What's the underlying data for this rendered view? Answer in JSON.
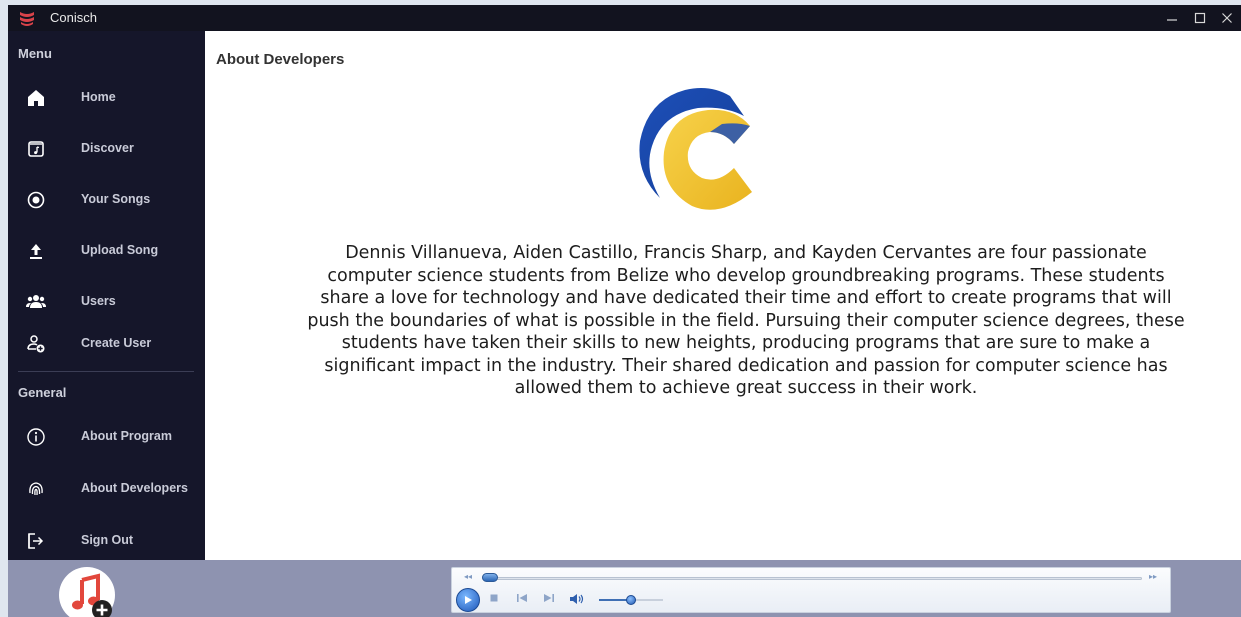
{
  "window": {
    "title": "Conisch",
    "controls": [
      "minimize-icon",
      "maximize-icon",
      "close-icon"
    ]
  },
  "sidebar": {
    "menu_title": "Menu",
    "menu_items": [
      {
        "label": "Home",
        "icon": "home-icon"
      },
      {
        "label": "Discover",
        "icon": "music-note-icon"
      },
      {
        "label": "Your Songs",
        "icon": "record-icon"
      },
      {
        "label": "Upload Song",
        "icon": "upload-icon"
      },
      {
        "label": "Users",
        "icon": "users-icon"
      },
      {
        "label": "Create User",
        "icon": "add-user-icon"
      }
    ],
    "general_title": "General",
    "general_items": [
      {
        "label": "About Program",
        "icon": "info-icon"
      },
      {
        "label": "About Developers",
        "icon": "fingerprint-icon"
      },
      {
        "label": "Sign Out",
        "icon": "sign-out-icon"
      }
    ]
  },
  "main": {
    "page_title": "About Developers",
    "logo": "conisch-c-logo",
    "about_text": "Dennis Villanueva, Aiden Castillo, Francis Sharp, and Kayden Cervantes are four passionate computer science students from Belize who develop groundbreaking programs. These students share a love for technology and have dedicated their time and effort to create programs that will push the boundaries of what is possible in the field. Pursuing their computer science degrees, these students have taken their skills to new heights, producing programs that are sure to make a significant impact in the industry. Their shared dedication and passion for computer science has allowed them to achieve great success in their work."
  },
  "player": {
    "controls": [
      "play-icon",
      "stop-icon",
      "previous-icon",
      "next-icon",
      "volume-icon"
    ],
    "seek_position": 0.0,
    "volume": 0.5
  },
  "colors": {
    "sidebar_bg": "#15162a",
    "titlebar_bg": "#12131f",
    "bottombar_bg": "#8e93b0",
    "logo_blue": "#1f4fb4",
    "logo_yellow": "#f2c233"
  }
}
